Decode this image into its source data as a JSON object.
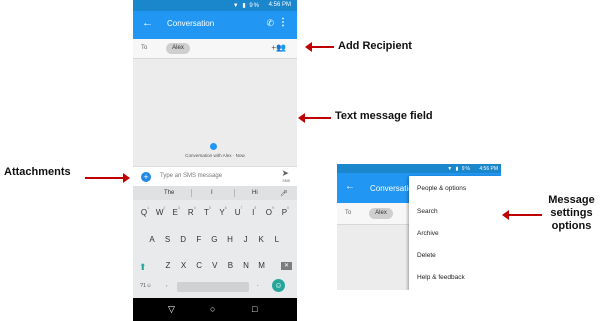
{
  "phone_main": {
    "status": {
      "time": "4:56 PM",
      "icons": "▼ ▮ 9%"
    },
    "app_bar": {
      "title": "Conversation"
    },
    "to_row": {
      "label": "To",
      "chip": "Alex"
    },
    "conversation": {
      "info": "Conversation with Alex · Now"
    },
    "sms_bar": {
      "placeholder": "Type an SMS message",
      "send_caption": "SMS"
    },
    "keyboard": {
      "suggestions": [
        "The",
        "I",
        "Hi"
      ],
      "row1": [
        "Q",
        "W",
        "E",
        "R",
        "T",
        "Y",
        "U",
        "I",
        "O",
        "P"
      ],
      "row1_hints": [
        "1",
        "2",
        "3",
        "4",
        "5",
        "6",
        "7",
        "8",
        "9",
        "0"
      ],
      "row2": [
        "A",
        "S",
        "D",
        "F",
        "G",
        "H",
        "J",
        "K",
        "L"
      ],
      "row3": [
        "Z",
        "X",
        "C",
        "V",
        "B",
        "N",
        "M"
      ],
      "symbols_key": "?1☺",
      "comma": ",",
      "period": "."
    }
  },
  "phone_menu": {
    "status": {
      "time": "4:56 PM",
      "icons": "▼ ▮ 9%"
    },
    "app_bar": {
      "title": "Conversatio"
    },
    "to_row": {
      "label": "To",
      "chip": "Alex"
    },
    "menu_items": [
      "People & options",
      "Search",
      "Archive",
      "Delete",
      "Help & feedback"
    ]
  },
  "annotations": {
    "add_recipient": "Add Recipient",
    "text_message_field": "Text message field",
    "attachments": "Attachments",
    "message_settings": [
      "Message",
      "settings",
      "options"
    ]
  },
  "colors": {
    "app_bar": "#2196f3",
    "status_bar": "#1a86cc",
    "accent": "#26a69a",
    "arrow": "#c00000"
  }
}
